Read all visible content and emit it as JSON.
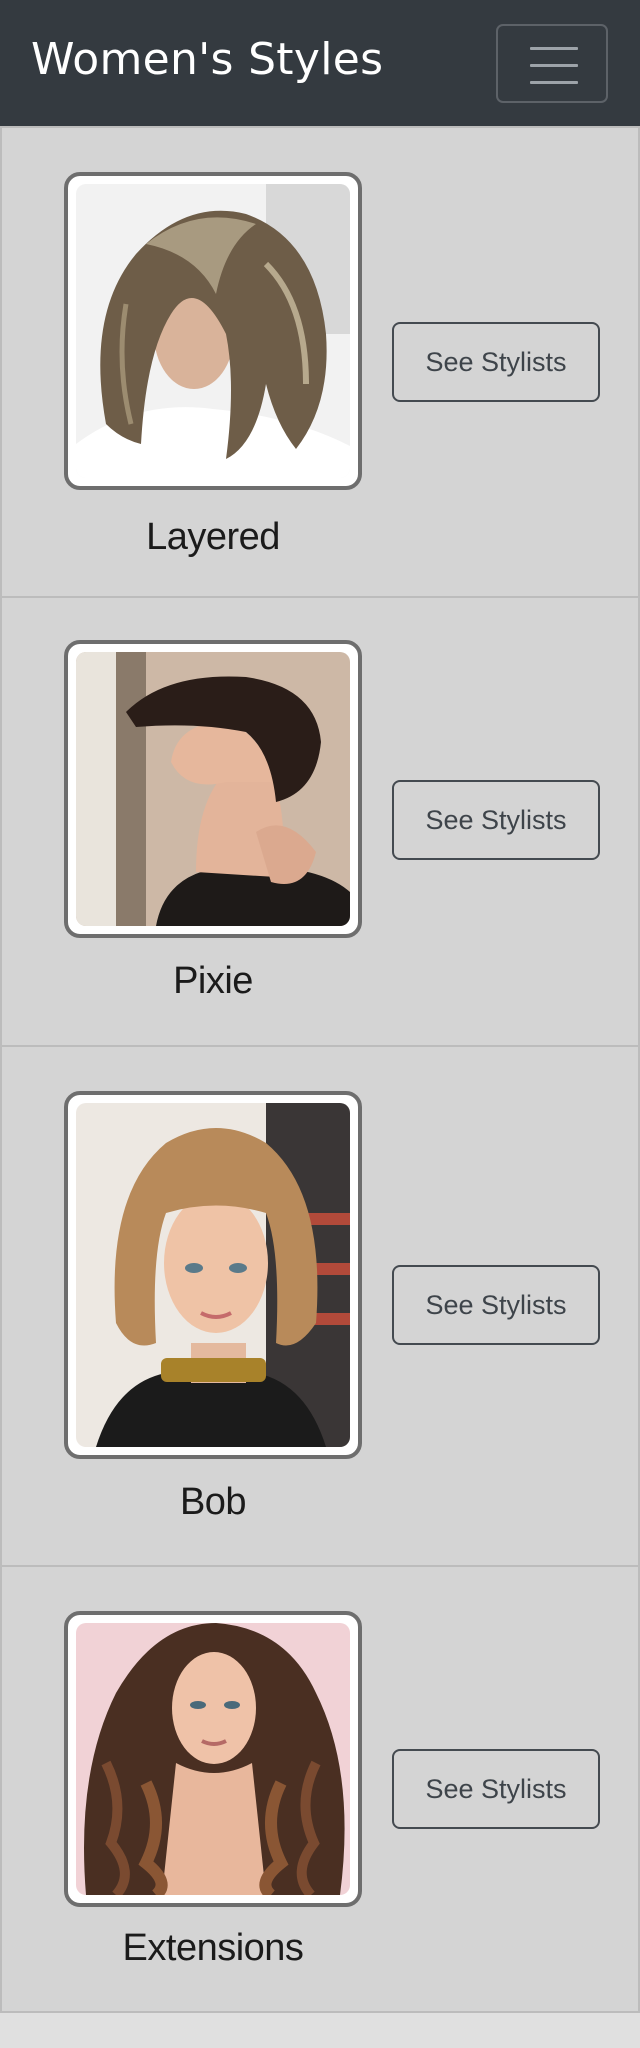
{
  "navbar": {
    "brand": "Women's Styles",
    "toggle_icon": "hamburger-menu-icon"
  },
  "styles": [
    {
      "name": "Layered",
      "button_label": "See Stylists"
    },
    {
      "name": "Pixie",
      "button_label": "See Stylists"
    },
    {
      "name": "Bob",
      "button_label": "See Stylists"
    },
    {
      "name": "Extensions",
      "button_label": "See Stylists"
    }
  ],
  "colors": {
    "navbar_bg": "#343a40",
    "card_bg": "#d4d4d4",
    "button_border": "#444a50"
  }
}
